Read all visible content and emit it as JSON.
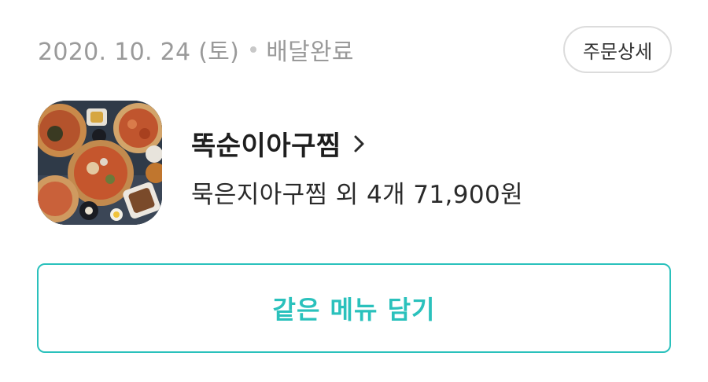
{
  "order": {
    "date": "2020. 10. 24 (토)",
    "status": "배달완료",
    "detail_button_label": "주문상세",
    "store_name": "똑순이아구찜",
    "summary": "묵은지아구찜 외 4개 71,900원",
    "reorder_button_label": "같은 메뉴 담기"
  },
  "colors": {
    "accent": "#2ac1bc",
    "muted_text": "#9a9a9a",
    "border": "#dcdcdc"
  },
  "icons": {
    "store_chevron": "chevron-right-icon",
    "thumbnail": "food-photo"
  }
}
